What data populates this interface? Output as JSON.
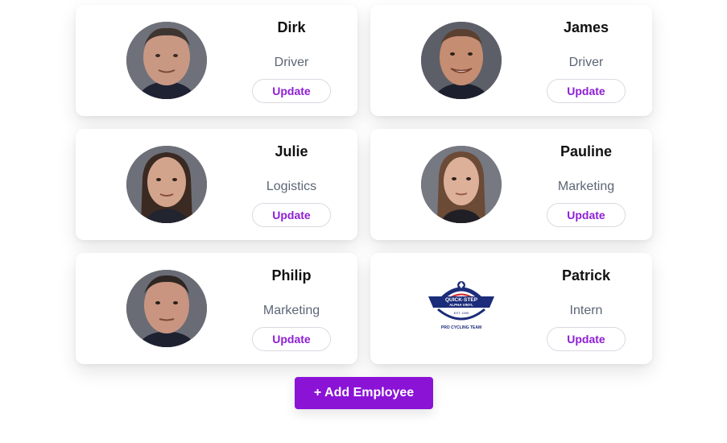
{
  "employees": [
    {
      "name": "Dirk",
      "role": "Driver",
      "update_label": "Update",
      "avatar": "person-photo"
    },
    {
      "name": "James",
      "role": "Driver",
      "update_label": "Update",
      "avatar": "person-photo"
    },
    {
      "name": "Julie",
      "role": "Logistics",
      "update_label": "Update",
      "avatar": "person-photo"
    },
    {
      "name": "Pauline",
      "role": "Marketing",
      "update_label": "Update",
      "avatar": "person-photo"
    },
    {
      "name": "Philip",
      "role": "Marketing",
      "update_label": "Update",
      "avatar": "person-photo"
    },
    {
      "name": "Patrick",
      "role": "Intern",
      "update_label": "Update",
      "avatar": "team-logo",
      "logo_text": [
        "QUICK·STEP",
        "ALPHA VINYL",
        "EST. 1999",
        "PRO CYCLING TEAM"
      ]
    }
  ],
  "add_button_label": "+ Add Employee",
  "colors": {
    "accent": "#8a13d6",
    "update_text": "#8d1fd3",
    "role_text": "#5c6677",
    "logo_blue": "#1b2c7a",
    "logo_red": "#d2232a"
  }
}
